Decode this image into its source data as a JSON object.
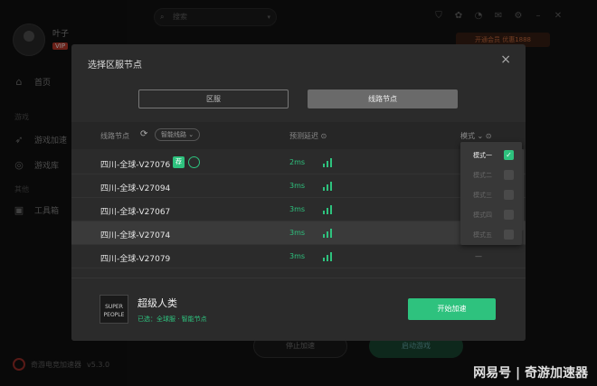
{
  "sidebar": {
    "username": "叶子",
    "vip": "VIP",
    "items": [
      {
        "label": "首页",
        "icon": "home-icon"
      },
      {
        "label": "游戏加速",
        "icon": "rocket-icon"
      },
      {
        "label": "游戏库",
        "icon": "gamepad-icon"
      },
      {
        "label": "工具箱",
        "icon": "toolbox-icon"
      }
    ],
    "sections": [
      "游戏",
      "其他"
    ],
    "app_name": "奇游电竞加速器",
    "version": "v5.3.0"
  },
  "topbar": {
    "search_placeholder": "搜索",
    "promo": "开通会员 优惠1888"
  },
  "background_buttons": [
    "停止加速",
    "启动游戏"
  ],
  "modal": {
    "title": "选择区服节点",
    "close": "×",
    "tabs": [
      "区服",
      "线路节点"
    ],
    "active_tab": 1,
    "columns": {
      "node": "线路节点",
      "filter_chip": "智能线路 ⌄",
      "latency": "预测延迟 ⊙",
      "mode": "模式 ⌄ ⊙"
    },
    "rows": [
      {
        "name": "四川-全球-V27076",
        "ms": "2ms",
        "tag": "荐",
        "selected": false
      },
      {
        "name": "四川-全球-V27094",
        "ms": "3ms",
        "selected": false
      },
      {
        "name": "四川-全球-V27067",
        "ms": "3ms",
        "selected": false
      },
      {
        "name": "四川-全球-V27074",
        "ms": "3ms",
        "selected": true
      },
      {
        "name": "四川-全球-V27079",
        "ms": "3ms",
        "selected": false
      }
    ],
    "mode_dash": "—",
    "mode_options": [
      {
        "label": "模式一",
        "checked": true
      },
      {
        "label": "模式二",
        "checked": false
      },
      {
        "label": "模式三",
        "checked": false
      },
      {
        "label": "模式四",
        "checked": false
      },
      {
        "label": "模式五",
        "checked": false
      }
    ],
    "game": {
      "name": "超级人类",
      "sub": "已选：全球服 · 智能节点",
      "cover_text": "SUPER PEOPLE"
    },
    "start_button": "开始加速"
  },
  "watermark": "网易号 | 奇游加速器",
  "colors": {
    "accent": "#2ec27e",
    "modal_bg": "#2b2b2b",
    "highlight_row": "#3a3a3a"
  }
}
